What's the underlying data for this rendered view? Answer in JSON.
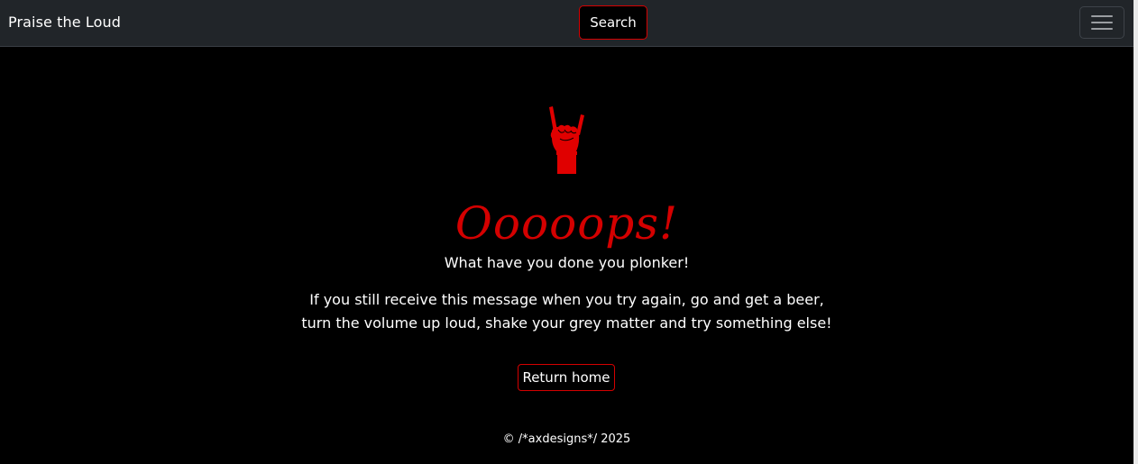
{
  "navbar": {
    "brand": "Praise the Loud",
    "search_label": "Search",
    "menu_icon": "hamburger-menu-icon"
  },
  "error": {
    "icon": "rock-horns-hand-icon",
    "title": "Ooooops!",
    "subtitle": "What have you done you plonker!",
    "message": "If you still receive this message when you try again, go and get a beer, turn the volume up loud, shake your grey matter and try something else!",
    "return_label": "Return home"
  },
  "footer": {
    "text": "© /*axdesigns*/ 2025"
  },
  "colors": {
    "accent": "#d40000",
    "navbar_bg": "#212529",
    "page_bg": "#000000"
  }
}
